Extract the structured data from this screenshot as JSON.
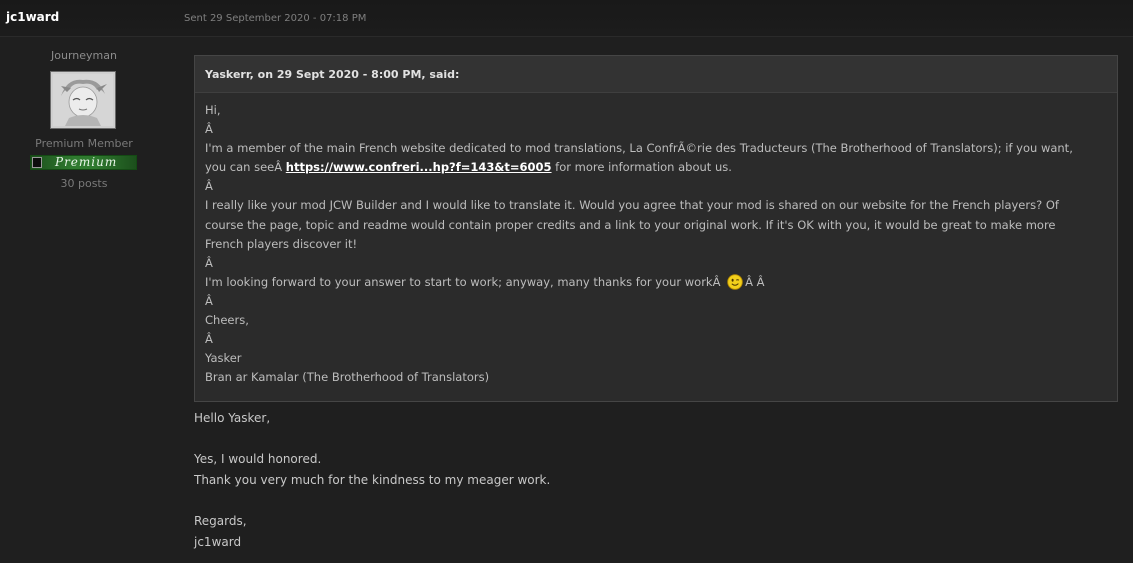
{
  "post": {
    "author": "jc1ward",
    "date": "Sent 29 September 2020 - 07:18 PM"
  },
  "author_info": {
    "title": "Journeyman",
    "group": "Premium Member",
    "badge": "Premium",
    "posts": "30 posts"
  },
  "quote": {
    "header": "Yaskerr, on 29 Sept 2020 - 8:00 PM, said:",
    "lines": {
      "l1": "Hi,",
      "l2": "Â ",
      "l3": "I'm a member of the main French website dedicated to mod translations, La ConfrÃ©rie des Traducteurs (The Brotherhood of Translators); if you want,",
      "l4_pre": "you can seeÂ ",
      "l4_link": "https://www.confreri...hp?f=143&t=6005",
      "l4_post": " for more information about us.",
      "l5": "Â ",
      "l6": "I really like your mod JCW Builder and I would like to translate it. Would you agree that your mod is shared on our website for the French players? Of",
      "l7": "course the page, topic and readme would contain proper credits and a link to your original work. If it's OK with you, it would be great to make more",
      "l8": "French players discover it!",
      "l9": "Â ",
      "l10_pre": "I'm looking forward to your answer to start to work; anyway, many thanks for your workÂ ",
      "l10_post": "Â Â ",
      "l11": "Â ",
      "l12": "Cheers,",
      "l13": "Â ",
      "l14": "Yasker",
      "l15": "Bran ar Kamalar (The Brotherhood of Translators)"
    }
  },
  "reply": {
    "r1": "Hello Yasker,",
    "r3": "Yes, I would honored.",
    "r4": "Thank you very much for the kindness to my meager work.",
    "r6": "Regards,",
    "r7": "jc1ward"
  },
  "icons": {
    "smiley": "wink-smiley-icon",
    "avatar": "anime-avatar-image"
  },
  "colors": {
    "background": "#1f1f1f",
    "quote_background": "#2b2b2b",
    "badge_green": "#2f7a2f",
    "link": "#ffffff"
  }
}
